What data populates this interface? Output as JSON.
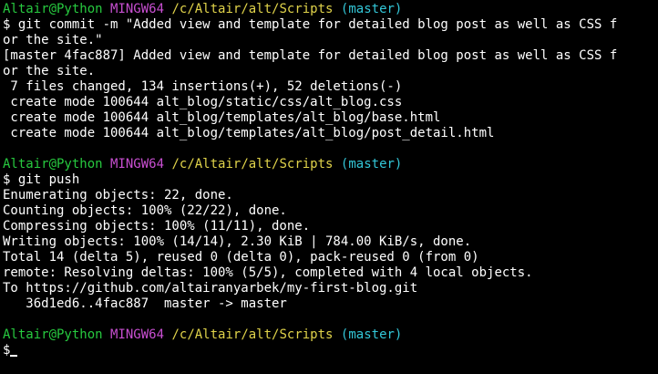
{
  "prompts": [
    {
      "user": "Altair@Python",
      "host": "MINGW64",
      "path": "/c/Altair/alt/Scripts",
      "branch": "(master)"
    },
    {
      "user": "Altair@Python",
      "host": "MINGW64",
      "path": "/c/Altair/alt/Scripts",
      "branch": "(master)"
    },
    {
      "user": "Altair@Python",
      "host": "MINGW64",
      "path": "/c/Altair/alt/Scripts",
      "branch": "(master)"
    }
  ],
  "block1": [
    "$ git commit -m \"Added view and template for detailed blog post as well as CSS f",
    "or the site.\"",
    "[master 4fac887] Added view and template for detailed blog post as well as CSS f",
    "or the site.",
    " 7 files changed, 134 insertions(+), 52 deletions(-)",
    " create mode 100644 alt_blog/static/css/alt_blog.css",
    " create mode 100644 alt_blog/templates/alt_blog/base.html",
    " create mode 100644 alt_blog/templates/alt_blog/post_detail.html"
  ],
  "block2": [
    "$ git push",
    "Enumerating objects: 22, done.",
    "Counting objects: 100% (22/22), done.",
    "Compressing objects: 100% (11/11), done.",
    "Writing objects: 100% (14/14), 2.30 KiB | 784.00 KiB/s, done.",
    "Total 14 (delta 5), reused 0 (delta 0), pack-reused 0 (from 0)",
    "remote: Resolving deltas: 100% (5/5), completed with 4 local objects.",
    "To https://github.com/altairanyarbek/my-first-blog.git",
    "   36d1ed6..4fac887  master -> master"
  ],
  "final_prompt_symbol": "$"
}
